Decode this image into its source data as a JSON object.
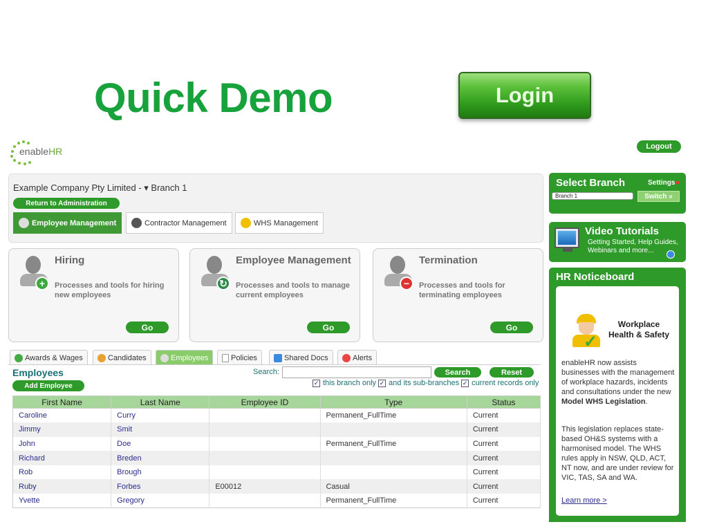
{
  "heading": "Quick Demo",
  "login_label": "Login",
  "logo": {
    "prefix": "enable",
    "suffix": "HR"
  },
  "logout_label": "Logout",
  "company": {
    "name": "Example Company Pty Limited - ",
    "branch": "▾ Branch 1",
    "return_label": "Return to Administration"
  },
  "modules": [
    {
      "label": "Employee Management",
      "icon": "employee-icon",
      "active": true
    },
    {
      "label": "Contractor Management",
      "icon": "contractor-icon",
      "active": false
    },
    {
      "label": "WHS Management",
      "icon": "hardhat-icon",
      "active": false
    }
  ],
  "cards": [
    {
      "title": "Hiring",
      "desc": "Processes and tools for hiring new employees",
      "go": "Go",
      "badge": "+",
      "badge_color": "#3aa83a"
    },
    {
      "title": "Employee Management",
      "desc": "Processes and tools to manage current employees",
      "go": "Go",
      "badge": "↻",
      "badge_color": "#2e8a4a"
    },
    {
      "title": "Termination",
      "desc": "Processes and tools for terminating employees",
      "go": "Go",
      "badge": "−",
      "badge_color": "#d33"
    }
  ],
  "tabs": [
    {
      "label": "Awards & Wages",
      "icon": "dollar-icon"
    },
    {
      "label": "Candidates",
      "icon": "candidate-icon"
    },
    {
      "label": "Employees",
      "icon": "employee-icon",
      "active": true
    },
    {
      "label": "Policies",
      "icon": "document-icon"
    },
    {
      "label": "Shared Docs",
      "icon": "shared-docs-icon"
    },
    {
      "label": "Alerts",
      "icon": "alert-icon"
    }
  ],
  "employees": {
    "title": "Employees",
    "add_label": "Add Employee",
    "search_label": "Search:",
    "search_value": "",
    "search_button": "Search",
    "reset_button": "Reset",
    "filters": [
      "this branch only",
      "and its sub-branches",
      "current records only"
    ],
    "columns": [
      "First Name",
      "Last Name",
      "Employee ID",
      "Type",
      "Status"
    ],
    "rows": [
      [
        "Caroline",
        "Curry",
        "",
        "Permanent_FullTime",
        "Current"
      ],
      [
        "Jimmy",
        "Smit",
        "",
        "",
        "Current"
      ],
      [
        "John",
        "Doe",
        "",
        "Permanent_FullTime",
        "Current"
      ],
      [
        "Richard",
        "Breden",
        "",
        "",
        "Current"
      ],
      [
        "Rob",
        "Brough",
        "",
        "",
        "Current"
      ],
      [
        "Ruby",
        "Forbes",
        "E00012",
        "Casual",
        "Current"
      ],
      [
        "Yvette",
        "Gregory",
        "",
        "Permanent_FullTime",
        "Current"
      ]
    ]
  },
  "sidebar": {
    "select_branch": "Select Branch",
    "settings": "Settings",
    "branch_value": "Branch 1",
    "switch_label": "Switch »",
    "video_title": "Video Tutorials",
    "video_sub": "Getting Started, Help Guides, Webinars and more...",
    "notice_title": "HR Noticeboard",
    "whs_title": "Workplace Health & Safety",
    "notice_p1": "enableHR now assists businesses with the management of workplace hazards, incidents and consultations under the new ",
    "notice_p1_bold": "Model WHS Legislation",
    "notice_p2": "This legislation replaces state-based OH&S systems with a harmonised model. The WHS rules apply in NSW, QLD, ACT, NT now, and are under review for VIC, TAS, SA and WA.",
    "learn_more": "Learn more >"
  },
  "colors": {
    "brand_green": "#2e9a2a",
    "title_green": "#17a23c",
    "link": "#2b2c8d",
    "teal": "#1c6f76"
  }
}
